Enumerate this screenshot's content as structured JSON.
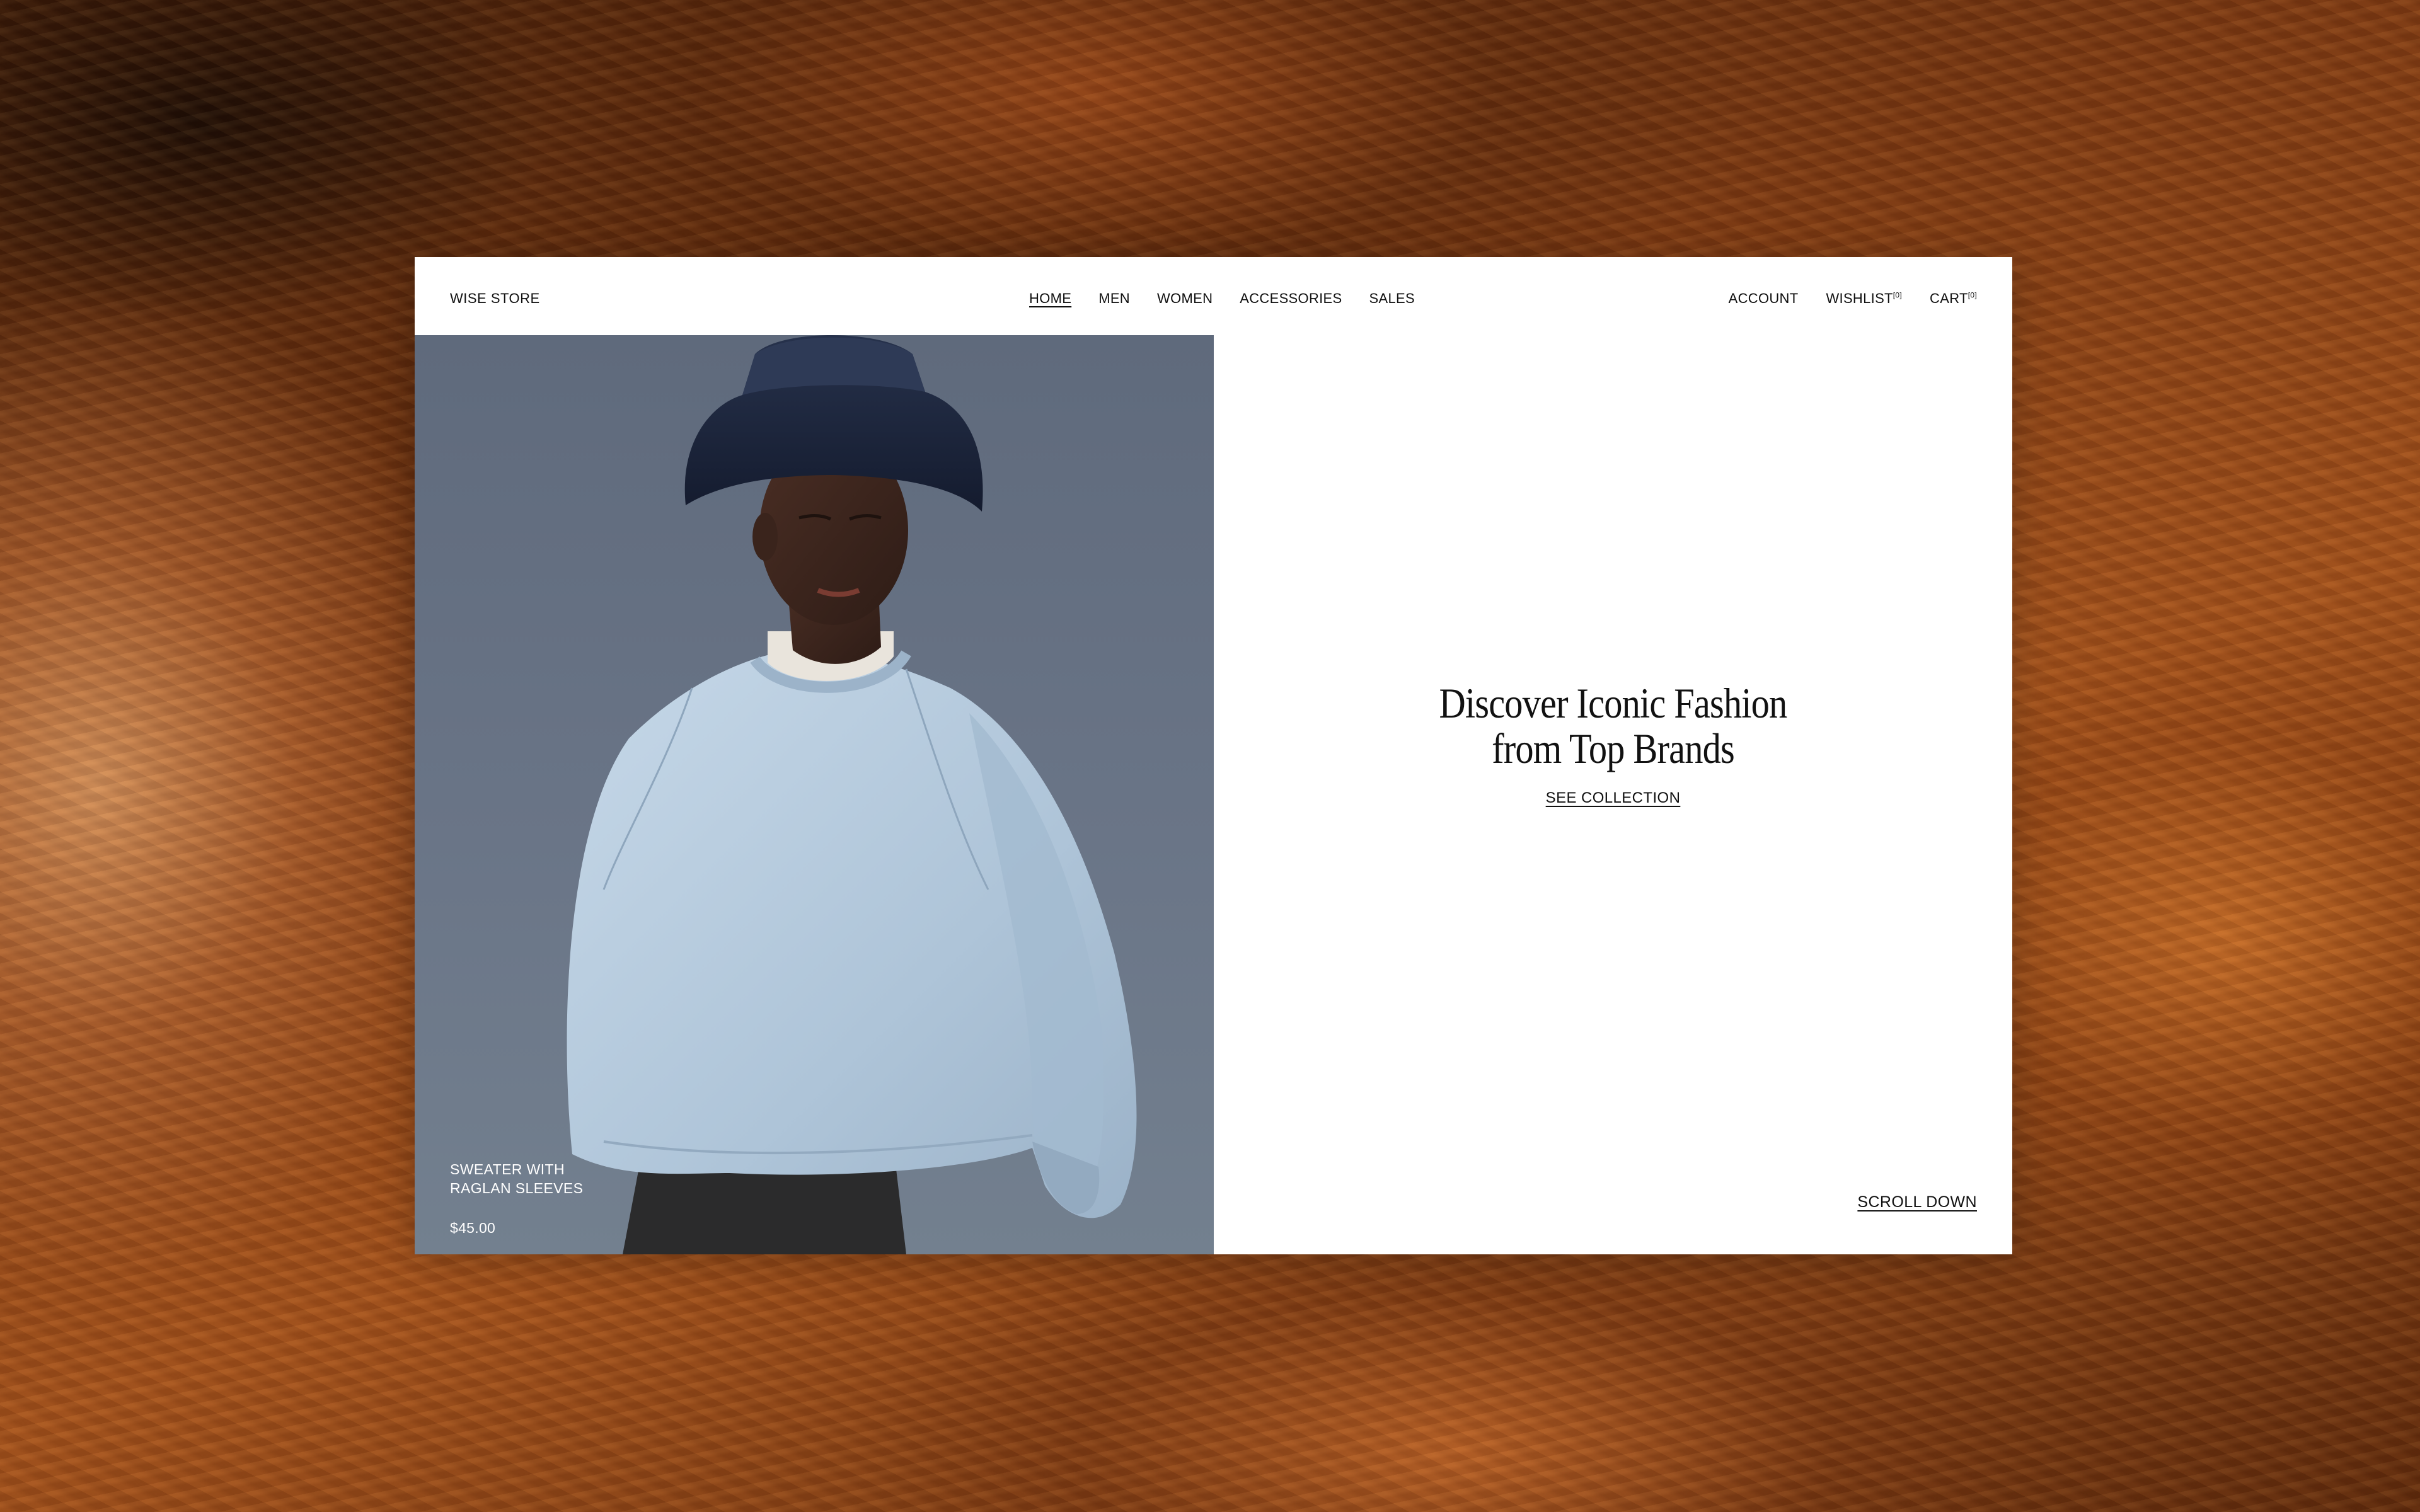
{
  "header": {
    "logo": "WISE STORE",
    "nav": [
      "HOME",
      "MEN",
      "WOMEN",
      "ACCESSORIES",
      "SALES"
    ],
    "active_nav": "HOME",
    "account": "ACCOUNT",
    "wishlist": "WISHLIST",
    "wishlist_count": "[0]",
    "cart": "CART",
    "cart_count": "[0]"
  },
  "product": {
    "name_line1": "SWEATER WITH",
    "name_line2": "RAGLAN SLEEVES",
    "price": "$45.00"
  },
  "hero": {
    "title_line1": "Discover Iconic Fashion",
    "title_line2": "from Top Brands",
    "cta": "SEE COLLECTION"
  },
  "scroll": "SCROLL DOWN",
  "colors": {
    "background_warm": "#a4521c",
    "photo_backdrop": "#66717f",
    "sweater": "#b9cde0",
    "hat": "#1e2a44"
  }
}
